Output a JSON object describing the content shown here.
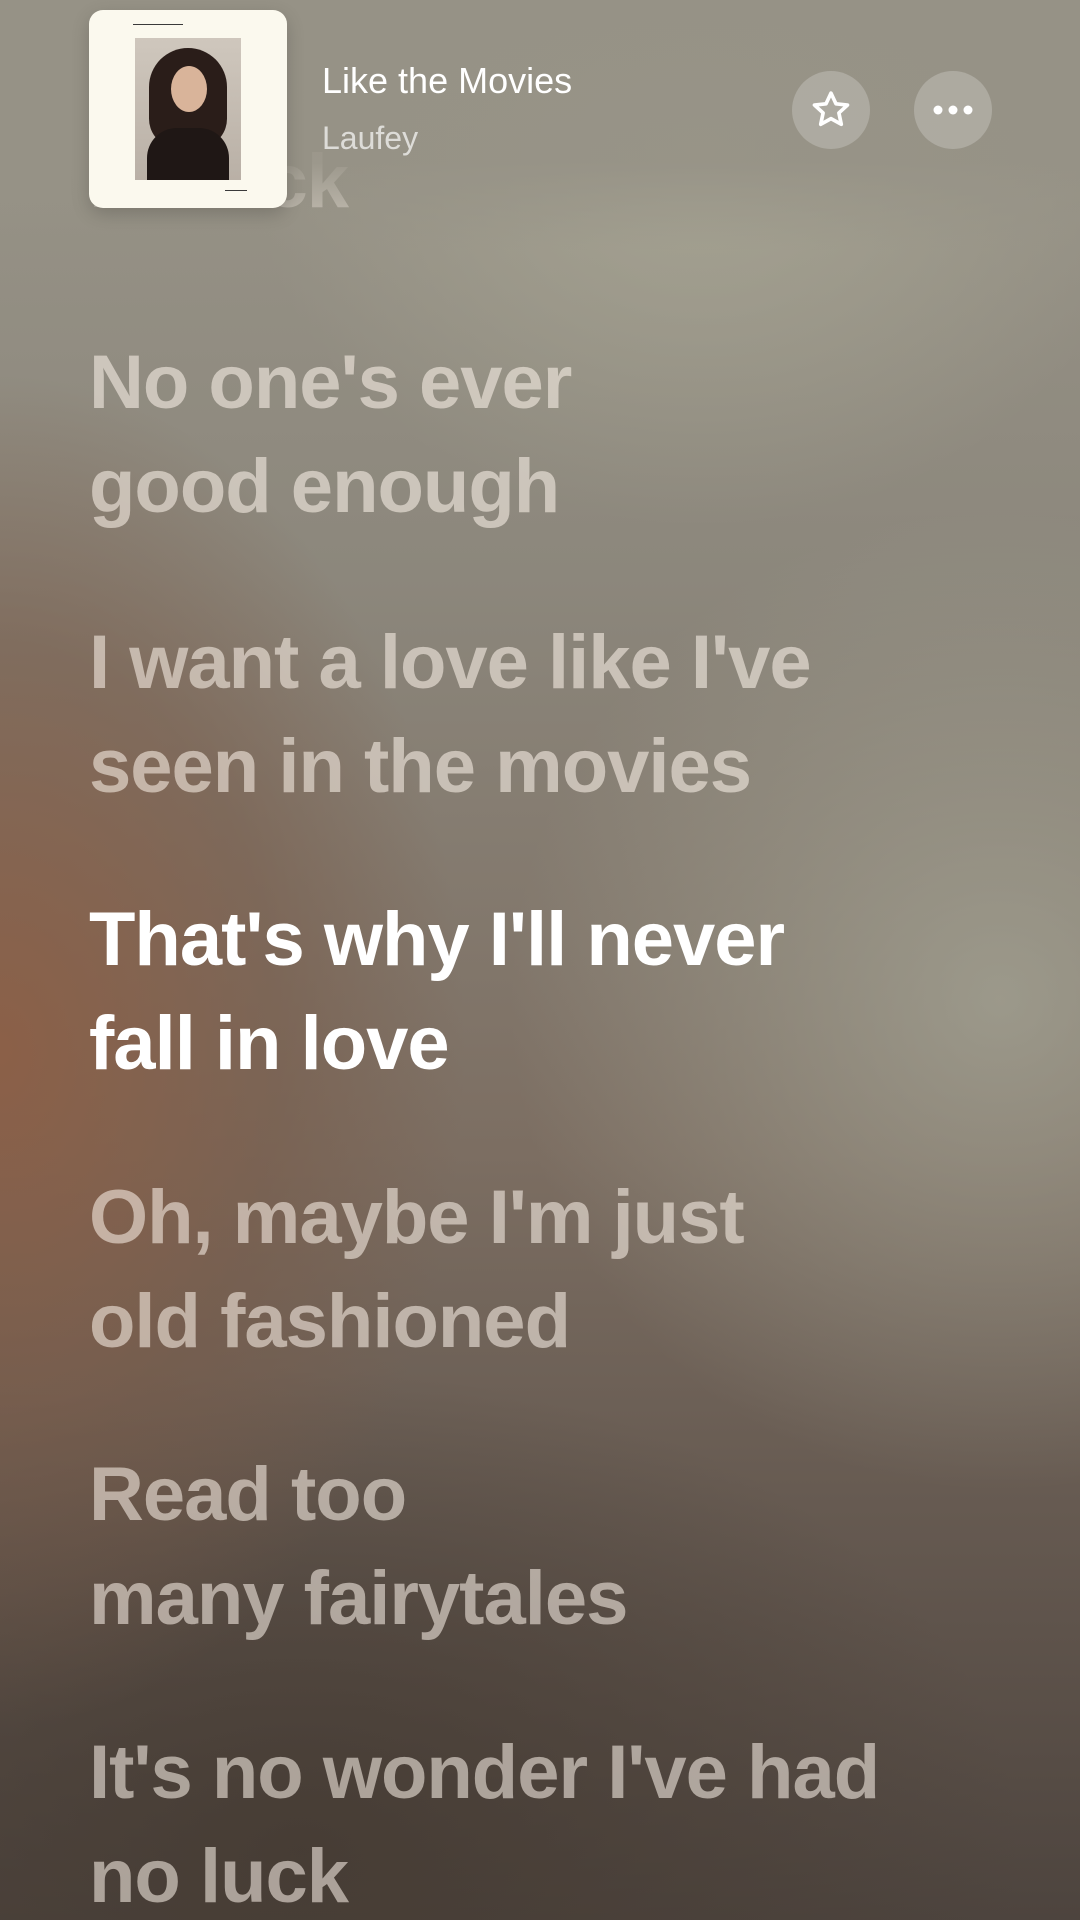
{
  "now_playing": {
    "title": "Like the Movies",
    "artist": "Laufey",
    "artwork": "album-cover-woman-portrait"
  },
  "actions": {
    "favorite_icon": "star-icon",
    "more_icon": "ellipsis-icon"
  },
  "lyrics": [
    {
      "lines": [
        "no luck"
      ],
      "state": "past"
    },
    {
      "lines": [
        "No one's ever",
        "good enough"
      ],
      "state": "upcoming"
    },
    {
      "lines": [
        "I want a love like I've",
        "seen in the movies"
      ],
      "state": "upcoming"
    },
    {
      "lines": [
        "That's why I'll never",
        "fall in love"
      ],
      "state": "active"
    },
    {
      "lines": [
        "Oh, maybe I'm just",
        "old fashioned"
      ],
      "state": "upcoming"
    },
    {
      "lines": [
        "Read too",
        "many fairytales"
      ],
      "state": "upcoming"
    },
    {
      "lines": [
        "It's no wonder I've had",
        "no luck"
      ],
      "state": "upcoming"
    }
  ],
  "colors": {
    "active_lyric": "#ffffff",
    "inactive_lyric": "rgba(255,246,236,0.55)"
  }
}
